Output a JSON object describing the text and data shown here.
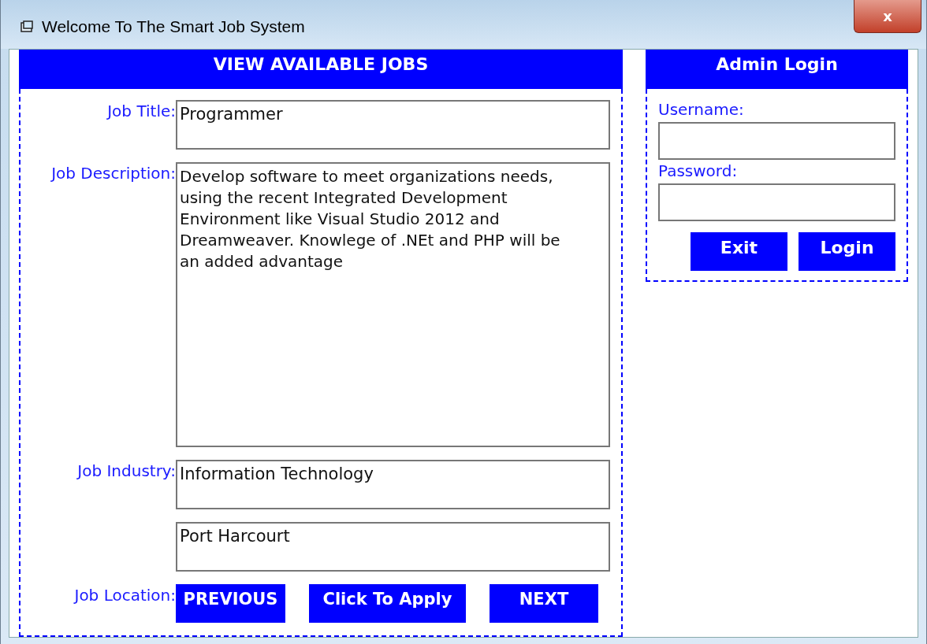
{
  "window": {
    "title": "Welcome To The Smart Job System",
    "close_label": "x"
  },
  "jobs_panel": {
    "header": "VIEW AVAILABLE JOBS",
    "fields": [
      {
        "label": "Job Title:",
        "value": "Programmer",
        "kind": "textbox"
      },
      {
        "label": "Job Description:",
        "value": "Develop software to meet organizations needs, using the recent Integrated Development Environment like Visual Studio 2012 and Dreamweaver. Knowlege of .NEt and PHP will be an added advantage",
        "kind": "textarea"
      },
      {
        "label": "Job Industry:",
        "value": "Information Technology",
        "kind": "textbox"
      },
      {
        "value": "Port Harcourt",
        "kind": "textbox"
      }
    ],
    "buttons_label": "Job Location:",
    "buttons": [
      "PREVIOUS",
      "Click To Apply",
      "NEXT"
    ]
  },
  "admin_panel": {
    "header": "Admin Login",
    "fields": [
      {
        "label": "Username:"
      },
      {
        "label": "Password:"
      }
    ],
    "buttons": [
      "Exit",
      "Login"
    ]
  }
}
